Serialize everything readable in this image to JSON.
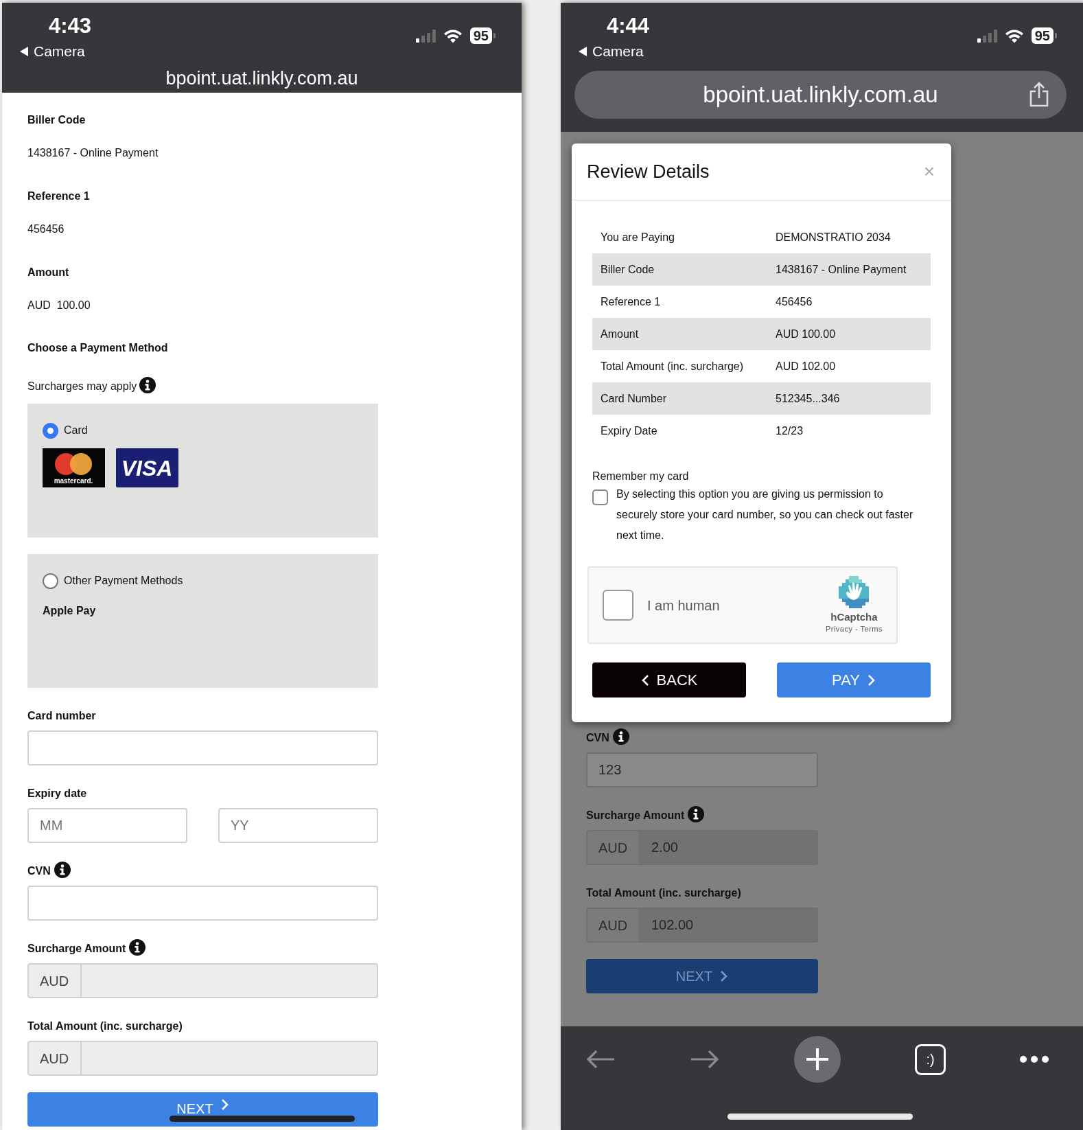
{
  "left_screen": {
    "status_bar": {
      "time": "4:43",
      "back_label": "Camera",
      "battery": "95"
    },
    "address_bar": {
      "url": "bpoint.uat.linkly.com.au"
    },
    "details": [
      {
        "label": "Biller Code",
        "value": "1438167 - Online Payment"
      },
      {
        "label": "Reference 1",
        "value": "456456"
      },
      {
        "label": "Amount",
        "value": "AUD  100.00"
      }
    ],
    "payment_method": {
      "heading": "Choose a Payment Method",
      "note": "Surcharges may apply",
      "options": [
        {
          "label": "Card",
          "selected": true,
          "logos": [
            {
              "kind": "mastercard",
              "text": "mastercard."
            },
            {
              "kind": "visa",
              "text": "VISA"
            }
          ]
        },
        {
          "label": "Other Payment Methods",
          "selected": false,
          "sub_label": "Apple Pay"
        }
      ]
    },
    "fields": [
      {
        "kind": "text",
        "label": "Card number",
        "info": false,
        "disabled": false
      },
      {
        "kind": "pair",
        "label": "Expiry date",
        "info": false,
        "disabled": false,
        "placeholders": [
          "MM",
          "YY"
        ]
      },
      {
        "kind": "text",
        "label": "CVN",
        "info": true,
        "disabled": false
      },
      {
        "kind": "currency",
        "label": "Surcharge Amount",
        "info": true,
        "disabled": true,
        "prefix": "AUD"
      },
      {
        "kind": "currency",
        "label": "Total Amount (inc. surcharge)",
        "info": false,
        "disabled": true,
        "prefix": "AUD"
      }
    ],
    "next_button": "NEXT"
  },
  "right_screen": {
    "status_bar": {
      "time": "4:44",
      "back_label": "Camera",
      "battery": "95"
    },
    "address_bar": {
      "url": "bpoint.uat.linkly.com.au"
    },
    "fields": [
      {
        "kind": "text",
        "label": "CVN",
        "info": true,
        "disabled": false,
        "value": "123"
      },
      {
        "kind": "currency",
        "label": "Surcharge Amount",
        "info": true,
        "disabled": true,
        "prefix": "AUD",
        "value": "2.00"
      },
      {
        "kind": "currency",
        "label": "Total Amount (inc. surcharge)",
        "info": false,
        "disabled": true,
        "prefix": "AUD",
        "value": "102.00"
      }
    ],
    "next_button": "NEXT",
    "modal": {
      "title": "Review Details",
      "close": "×",
      "rows": [
        {
          "label": "You are Paying",
          "value": "DEMONSTRATIO 2034"
        },
        {
          "label": "Biller Code",
          "value": "1438167 - Online Payment"
        },
        {
          "label": "Reference 1",
          "value": "456456"
        },
        {
          "label": "Amount",
          "value": "AUD 100.00"
        },
        {
          "label": "Total Amount (inc. surcharge)",
          "value": "AUD 102.00"
        },
        {
          "label": "Card Number",
          "value": "512345...346"
        },
        {
          "label": "Expiry Date",
          "value": "12/23"
        }
      ],
      "remember": {
        "label": "Remember my card",
        "checked": false,
        "text": "By selecting this option you are giving us permission to securely store your card number, so you can check out faster next time."
      },
      "captcha": {
        "label": "I am human",
        "checked": false,
        "brand": "hCaptcha",
        "links": "Privacy - Terms"
      },
      "back_button": "BACK",
      "pay_button": "PAY"
    },
    "toolbar": {
      "tabs_label": ":)"
    }
  }
}
